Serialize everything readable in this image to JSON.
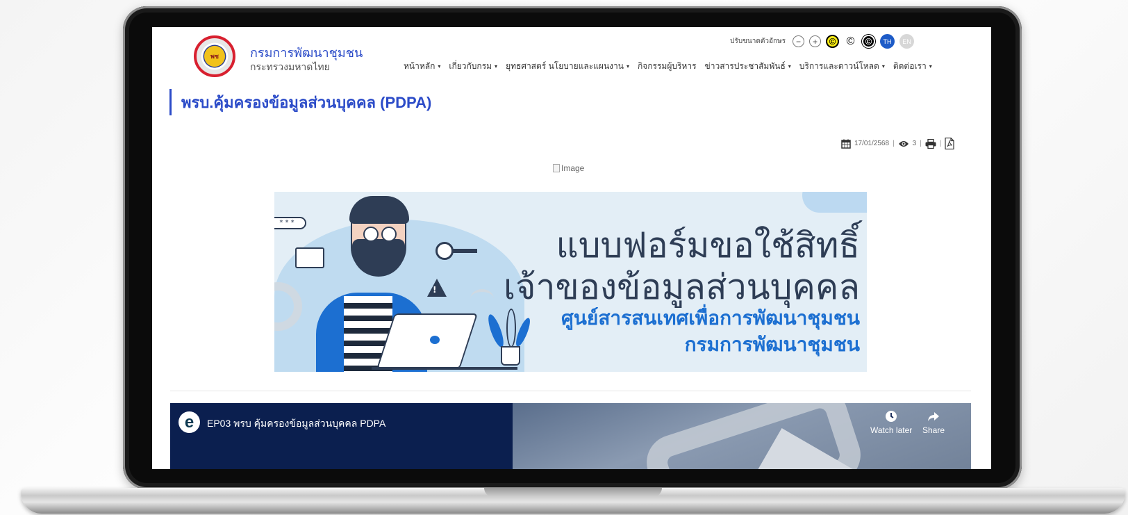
{
  "org": {
    "name": "กรมการพัฒนาชุมชน",
    "ministry": "กระทรวงมหาดไทย",
    "logo_text": "พช"
  },
  "accessibility": {
    "font_size_label": "ปรับขนาดตัวอักษร",
    "decrease": "−",
    "increase": "+",
    "contrast_glyph": "©",
    "lang_th": "TH",
    "lang_en": "EN"
  },
  "nav": {
    "items": [
      {
        "label": "หน้าหลัก",
        "dropdown": true
      },
      {
        "label": "เกี่ยวกับกรม",
        "dropdown": true
      },
      {
        "label": "ยุทธศาสตร์ นโยบายและแผนงาน",
        "dropdown": true
      },
      {
        "label": "กิจกรรมผู้บริหาร",
        "dropdown": false
      },
      {
        "label": "ข่าวสารประชาสัมพันธ์",
        "dropdown": true
      },
      {
        "label": "บริการและดาวน์โหลด",
        "dropdown": true
      },
      {
        "label": "ติดต่อเรา",
        "dropdown": true
      }
    ],
    "caret": "▾"
  },
  "page": {
    "title": "พรบ.คุ้มครองข้อมูลส่วนบุคคล (PDPA)",
    "date": "17/01/2568",
    "views": "3",
    "broken_image_alt": "Image"
  },
  "banner": {
    "line1": "แบบฟอร์มขอใช้สิทธิ์",
    "line2": "เจ้าของข้อมูลส่วนบุคคล",
    "line3": "ศูนย์สารสนเทศเพื่อการพัฒนาชุมชน",
    "line4": "กรมการพัฒนาชุมชน",
    "password_mask": "* * *"
  },
  "video": {
    "channel_logo": "e",
    "title": "EP03 พรบ คุ้มครองข้อมูลส่วนบุคคล PDPA",
    "watch_later": "Watch later",
    "share": "Share"
  },
  "colors": {
    "brand_blue": "#2b4bc8",
    "banner_blue": "#1c6fd1",
    "video_bg": "#0b1f4f"
  },
  "icons": [
    "calendar-icon",
    "eye-icon",
    "print-icon",
    "pdf-icon",
    "clock-icon",
    "share-icon"
  ]
}
